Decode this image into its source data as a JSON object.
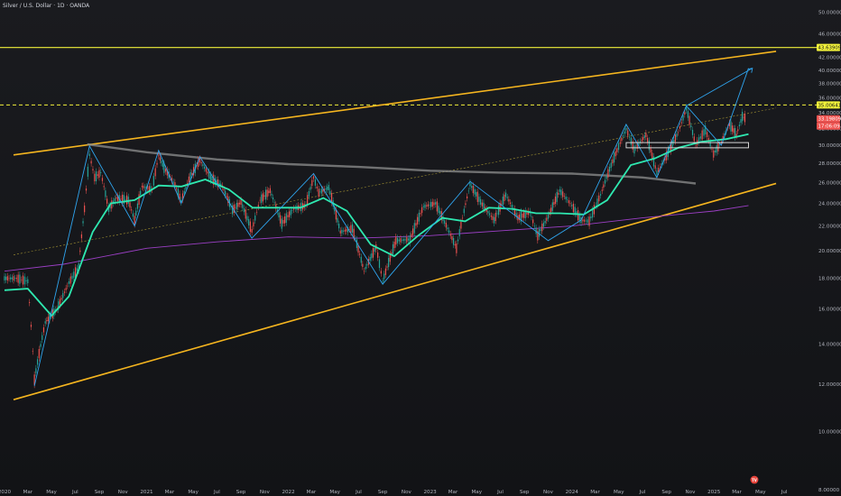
{
  "header": {
    "title": "Silver / U.S. Dollar · 1D · OANDA"
  },
  "colors": {
    "background": "#131417",
    "channel": "#f5b51f",
    "midline": "#d9c23a",
    "hline": "#f2f23a",
    "zigzag": "#2fa5ef",
    "ma_fast": "#2ee8b0",
    "ma_slow": "#8f8f8f",
    "ma_long": "#9b3fc4",
    "price": "#ef5350",
    "candle_up": "#26a69a",
    "candle_down": "#ef5350"
  },
  "price_tags": {
    "hline_upper": "43.63909",
    "hline_lower": "35.00641",
    "last_price": "33.19809",
    "countdown": "17:06:09"
  },
  "chart_data": {
    "type": "line",
    "title": "Silver / U.S. Dollar · 1D · OANDA",
    "xlabel": "",
    "ylabel": "",
    "grid": false,
    "log_scale": true,
    "ylim": [
      8,
      52
    ],
    "xlim": [
      "2020-01-01",
      "2025-07-31"
    ],
    "y_ticks": [
      "50.00000",
      "46.00000",
      "42.00000",
      "40.00000",
      "38.00000",
      "36.00000",
      "34.00000",
      "32.00000",
      "30.00000",
      "28.00000",
      "26.00000",
      "24.00000",
      "22.00000",
      "20.00000",
      "18.00000",
      "16.00000",
      "14.00000",
      "12.00000",
      "10.00000",
      "8.00000"
    ],
    "x_ticks": [
      {
        "label": "2020",
        "date": "2020-01-01"
      },
      {
        "label": "Mar",
        "date": "2020-03-01"
      },
      {
        "label": "May",
        "date": "2020-05-01"
      },
      {
        "label": "Jul",
        "date": "2020-07-01"
      },
      {
        "label": "Sep",
        "date": "2020-09-01"
      },
      {
        "label": "Nov",
        "date": "2020-11-01"
      },
      {
        "label": "2021",
        "date": "2021-01-01"
      },
      {
        "label": "Mar",
        "date": "2021-03-01"
      },
      {
        "label": "May",
        "date": "2021-05-01"
      },
      {
        "label": "Jul",
        "date": "2021-07-01"
      },
      {
        "label": "Sep",
        "date": "2021-09-01"
      },
      {
        "label": "Nov",
        "date": "2021-11-01"
      },
      {
        "label": "2022",
        "date": "2022-01-01"
      },
      {
        "label": "Mar",
        "date": "2022-03-01"
      },
      {
        "label": "May",
        "date": "2022-05-01"
      },
      {
        "label": "Jul",
        "date": "2022-07-01"
      },
      {
        "label": "Sep",
        "date": "2022-09-01"
      },
      {
        "label": "Nov",
        "date": "2022-11-01"
      },
      {
        "label": "2023",
        "date": "2023-01-01"
      },
      {
        "label": "Mar",
        "date": "2023-03-01"
      },
      {
        "label": "May",
        "date": "2023-05-01"
      },
      {
        "label": "Jul",
        "date": "2023-07-01"
      },
      {
        "label": "Sep",
        "date": "2023-09-01"
      },
      {
        "label": "Nov",
        "date": "2023-11-01"
      },
      {
        "label": "2024",
        "date": "2024-01-01"
      },
      {
        "label": "Mar",
        "date": "2024-03-01"
      },
      {
        "label": "May",
        "date": "2024-05-01"
      },
      {
        "label": "Jul",
        "date": "2024-07-01"
      },
      {
        "label": "Sep",
        "date": "2024-09-01"
      },
      {
        "label": "Nov",
        "date": "2024-11-01"
      },
      {
        "label": "2025",
        "date": "2025-01-01"
      },
      {
        "label": "Mar",
        "date": "2025-03-01"
      },
      {
        "label": "May",
        "date": "2025-05-01"
      },
      {
        "label": "Jul",
        "date": "2025-07-01"
      }
    ],
    "horizontal_lines": [
      {
        "value": 43.63909,
        "style": "solid"
      },
      {
        "value": 35.00641,
        "style": "dashed"
      }
    ],
    "channel": {
      "upper": [
        [
          "2020-01-01",
          28.9
        ],
        [
          "2025-06-10",
          43.0
        ]
      ],
      "lower": [
        [
          "2020-01-01",
          11.3
        ],
        [
          "2025-06-10",
          25.9
        ]
      ],
      "mid": [
        [
          "2020-01-01",
          19.7
        ],
        [
          "2025-06-10",
          34.6
        ]
      ]
    },
    "zigzag": [
      [
        "2020-03-18",
        11.9
      ],
      [
        "2020-08-07",
        29.9
      ],
      [
        "2020-12-01",
        22.0
      ],
      [
        "2021-02-01",
        29.4
      ],
      [
        "2021-03-31",
        24.0
      ],
      [
        "2021-05-18",
        28.7
      ],
      [
        "2021-09-29",
        21.0
      ],
      [
        "2022-03-07",
        26.9
      ],
      [
        "2022-09-01",
        17.6
      ],
      [
        "2023-04-14",
        26.1
      ],
      [
        "2023-11-01",
        20.8
      ],
      [
        "2024-01-25",
        22.5
      ],
      [
        "2024-05-20",
        32.5
      ],
      [
        "2024-08-07",
        26.5
      ],
      [
        "2024-10-22",
        34.9
      ],
      [
        "2025-01-20",
        30.0
      ],
      [
        "2025-03-31",
        40.3
      ]
    ],
    "support_box": {
      "x0": "2024-05-20",
      "x1": "2025-03-31",
      "y0": 29.7,
      "y1": 30.3
    },
    "series": [
      {
        "values": [
          [
            "2020-01-01",
            18.0
          ],
          [
            "2020-02-01",
            18.0
          ],
          [
            "2020-03-01",
            17.8
          ],
          [
            "2020-03-18",
            12.2
          ],
          [
            "2020-04-15",
            15.2
          ],
          [
            "2020-05-15",
            16.0
          ],
          [
            "2020-06-15",
            17.7
          ],
          [
            "2020-07-10",
            18.8
          ],
          [
            "2020-07-25",
            23.5
          ],
          [
            "2020-08-07",
            28.9
          ],
          [
            "2020-08-20",
            26.5
          ],
          [
            "2020-09-05",
            27.0
          ],
          [
            "2020-09-25",
            23.5
          ],
          [
            "2020-10-15",
            24.5
          ],
          [
            "2020-11-15",
            24.3
          ],
          [
            "2020-12-01",
            22.5
          ],
          [
            "2020-12-20",
            25.6
          ],
          [
            "2021-01-15",
            25.3
          ],
          [
            "2021-02-01",
            28.8
          ],
          [
            "2021-02-15",
            27.5
          ],
          [
            "2021-03-15",
            25.8
          ],
          [
            "2021-03-31",
            24.2
          ],
          [
            "2021-04-20",
            26.3
          ],
          [
            "2021-05-18",
            28.3
          ],
          [
            "2021-06-15",
            26.5
          ],
          [
            "2021-07-15",
            25.6
          ],
          [
            "2021-08-10",
            23.4
          ],
          [
            "2021-09-01",
            24.1
          ],
          [
            "2021-09-29",
            21.6
          ],
          [
            "2021-10-20",
            24.3
          ],
          [
            "2021-11-15",
            25.2
          ],
          [
            "2021-12-15",
            22.2
          ],
          [
            "2022-01-15",
            23.5
          ],
          [
            "2022-02-15",
            23.8
          ],
          [
            "2022-03-07",
            26.5
          ],
          [
            "2022-03-20",
            25.0
          ],
          [
            "2022-04-15",
            25.5
          ],
          [
            "2022-05-15",
            21.5
          ],
          [
            "2022-06-15",
            21.8
          ],
          [
            "2022-07-15",
            18.5
          ],
          [
            "2022-08-15",
            20.3
          ],
          [
            "2022-09-01",
            17.8
          ],
          [
            "2022-10-05",
            20.8
          ],
          [
            "2022-11-10",
            20.9
          ],
          [
            "2022-12-15",
            23.7
          ],
          [
            "2023-01-15",
            24.0
          ],
          [
            "2023-02-15",
            21.8
          ],
          [
            "2023-03-10",
            20.2
          ],
          [
            "2023-04-14",
            25.8
          ],
          [
            "2023-05-15",
            23.9
          ],
          [
            "2023-06-15",
            22.5
          ],
          [
            "2023-07-15",
            24.8
          ],
          [
            "2023-08-15",
            22.7
          ],
          [
            "2023-09-15",
            23.2
          ],
          [
            "2023-10-05",
            21.2
          ],
          [
            "2023-11-01",
            22.8
          ],
          [
            "2023-12-01",
            25.2
          ],
          [
            "2024-01-01",
            23.8
          ],
          [
            "2024-01-25",
            22.5
          ],
          [
            "2024-02-15",
            22.4
          ],
          [
            "2024-03-15",
            24.8
          ],
          [
            "2024-04-15",
            28.2
          ],
          [
            "2024-05-20",
            31.9
          ],
          [
            "2024-06-10",
            29.5
          ],
          [
            "2024-07-10",
            31.2
          ],
          [
            "2024-08-07",
            27.0
          ],
          [
            "2024-09-01",
            28.8
          ],
          [
            "2024-10-01",
            31.5
          ],
          [
            "2024-10-22",
            34.5
          ],
          [
            "2024-11-15",
            30.0
          ],
          [
            "2024-12-10",
            31.8
          ],
          [
            "2024-12-31",
            29.0
          ],
          [
            "2025-01-20",
            30.4
          ],
          [
            "2025-02-10",
            32.5
          ],
          [
            "2025-02-28",
            31.2
          ],
          [
            "2025-03-15",
            33.5
          ],
          [
            "2025-03-25",
            33.2
          ]
        ]
      },
      {
        "values": [
          [
            "2020-01-01",
            17.2
          ],
          [
            "2020-03-01",
            17.3
          ],
          [
            "2020-05-01",
            15.6
          ],
          [
            "2020-06-15",
            16.8
          ],
          [
            "2020-08-15",
            21.5
          ],
          [
            "2020-10-01",
            24.0
          ],
          [
            "2020-12-01",
            24.3
          ],
          [
            "2021-02-01",
            25.7
          ],
          [
            "2021-04-01",
            25.6
          ],
          [
            "2021-06-01",
            26.3
          ],
          [
            "2021-08-01",
            25.3
          ],
          [
            "2021-10-01",
            23.6
          ],
          [
            "2021-12-01",
            23.6
          ],
          [
            "2022-02-01",
            23.6
          ],
          [
            "2022-04-01",
            24.5
          ],
          [
            "2022-06-01",
            23.3
          ],
          [
            "2022-08-01",
            20.5
          ],
          [
            "2022-10-01",
            19.6
          ],
          [
            "2022-12-01",
            21.2
          ],
          [
            "2023-02-01",
            22.7
          ],
          [
            "2023-04-01",
            22.4
          ],
          [
            "2023-06-01",
            23.6
          ],
          [
            "2023-08-01",
            23.5
          ],
          [
            "2023-10-01",
            23.1
          ],
          [
            "2023-12-01",
            23.1
          ],
          [
            "2024-02-01",
            23.0
          ],
          [
            "2024-04-01",
            24.3
          ],
          [
            "2024-06-01",
            27.8
          ],
          [
            "2024-08-01",
            28.5
          ],
          [
            "2024-10-01",
            29.7
          ],
          [
            "2024-12-01",
            30.4
          ],
          [
            "2025-02-01",
            30.7
          ],
          [
            "2025-03-31",
            31.3
          ]
        ]
      },
      {
        "values": [
          [
            "2020-08-01",
            30.1
          ],
          [
            "2021-01-01",
            29.2
          ],
          [
            "2021-07-01",
            28.4
          ],
          [
            "2022-01-01",
            27.9
          ],
          [
            "2022-07-01",
            27.6
          ],
          [
            "2023-01-01",
            27.2
          ],
          [
            "2023-07-01",
            27.0
          ],
          [
            "2024-01-01",
            26.9
          ],
          [
            "2024-07-01",
            26.5
          ],
          [
            "2024-11-15",
            25.9
          ]
        ]
      },
      {
        "values": [
          [
            "2020-01-01",
            18.5
          ],
          [
            "2020-06-01",
            19.0
          ],
          [
            "2021-01-01",
            20.2
          ],
          [
            "2021-07-01",
            20.7
          ],
          [
            "2022-01-01",
            21.1
          ],
          [
            "2022-07-01",
            21.0
          ],
          [
            "2023-01-01",
            21.2
          ],
          [
            "2023-07-01",
            21.6
          ],
          [
            "2024-01-01",
            22.0
          ],
          [
            "2024-07-01",
            22.7
          ],
          [
            "2025-01-01",
            23.3
          ],
          [
            "2025-03-31",
            23.8
          ]
        ]
      }
    ],
    "projection": {
      "from": [
        "2024-10-22",
        34.9
      ],
      "to": [
        "2025-04-10",
        40.3
      ]
    }
  }
}
